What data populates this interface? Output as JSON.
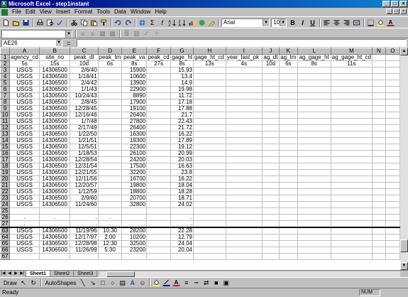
{
  "window": {
    "title": "Microsoft Excel - step1instant"
  },
  "menu": [
    "File",
    "Edit",
    "View",
    "Insert",
    "Format",
    "Tools",
    "Data",
    "Window",
    "Help"
  ],
  "toolbar": {
    "font_name": "Arial",
    "font_size": "10",
    "bold": "B",
    "italic": "I",
    "underline": "U"
  },
  "formula": {
    "cell_ref": "AE26",
    "eq": "="
  },
  "columns": [
    "A",
    "B",
    "C",
    "D",
    "E",
    "F",
    "G",
    "H",
    "I",
    "J",
    "K",
    "L",
    "M",
    "N",
    "O"
  ],
  "header_row1": [
    "agency_cd",
    "site_no",
    "peak_dt",
    "peak_tm",
    "peak_va",
    "peak_cd",
    "gage_ht",
    "gage_ht_cd",
    "year_last_pk",
    "ag_dt",
    "ag_tm",
    "ag_gage_ht",
    "ag_gage_ht_cd",
    "",
    ""
  ],
  "header_row2": [
    "5s",
    "15s",
    "10d",
    "6s",
    "8s",
    "27s",
    "8s",
    "13s",
    "4s",
    "10d",
    "6s",
    "8s",
    "11s",
    "",
    ""
  ],
  "rows": [
    {
      "n": "3",
      "a": "USGS",
      "b": "14306500",
      "c": "2/6/40",
      "d": "",
      "e": "15900",
      "g": "15.93"
    },
    {
      "n": "4",
      "a": "USGS",
      "b": "14306500",
      "c": "1/18/41",
      "d": "",
      "e": "10600",
      "g": "13.4"
    },
    {
      "n": "5",
      "a": "USGS",
      "b": "14306500",
      "c": "2/4/42",
      "d": "",
      "e": "13900",
      "g": "14.9"
    },
    {
      "n": "6",
      "a": "USGS",
      "b": "14306500",
      "c": "1/1/43",
      "d": "",
      "e": "22900",
      "g": "19.98"
    },
    {
      "n": "7",
      "a": "USGS",
      "b": "14306500",
      "c": "10/24/43",
      "d": "",
      "e": "8890",
      "g": "11.72"
    },
    {
      "n": "8",
      "a": "USGS",
      "b": "14306500",
      "c": "2/8/45",
      "d": "",
      "e": "17900",
      "g": "17.18"
    },
    {
      "n": "9",
      "a": "USGS",
      "b": "14306500",
      "c": "12/28/45",
      "d": "",
      "e": "19100",
      "g": "17.88"
    },
    {
      "n": "10",
      "a": "USGS",
      "b": "14306500",
      "c": "12/16/46",
      "d": "",
      "e": "26400",
      "g": "21.7"
    },
    {
      "n": "11",
      "a": "USGS",
      "b": "14306500",
      "c": "1/7/48",
      "d": "",
      "e": "27800",
      "g": "22.43"
    },
    {
      "n": "12",
      "a": "USGS",
      "b": "14306500",
      "c": "2/17/49",
      "d": "",
      "e": "26400",
      "g": "21.72"
    },
    {
      "n": "13",
      "a": "USGS",
      "b": "14306500",
      "c": "1/22/50",
      "d": "",
      "e": "16300",
      "g": "16.22"
    },
    {
      "n": "14",
      "a": "USGS",
      "b": "14306500",
      "c": "1/21/51",
      "d": "",
      "e": "19300",
      "g": "17.89"
    },
    {
      "n": "15",
      "a": "USGS",
      "b": "14306500",
      "c": "12/5/51",
      "d": "",
      "e": "22300",
      "g": "19.12"
    },
    {
      "n": "16",
      "a": "USGS",
      "b": "14306500",
      "c": "1/18/53",
      "d": "",
      "e": "26100",
      "g": "20.99"
    },
    {
      "n": "17",
      "a": "USGS",
      "b": "14306500",
      "c": "12/28/54",
      "d": "",
      "e": "24200",
      "g": "20.03"
    },
    {
      "n": "18",
      "a": "USGS",
      "b": "14306500",
      "c": "12/31/54",
      "d": "",
      "e": "17500",
      "g": "16.63"
    },
    {
      "n": "19",
      "a": "USGS",
      "b": "14306500",
      "c": "12/21/55",
      "d": "",
      "e": "32200",
      "g": "23.8"
    },
    {
      "n": "20",
      "a": "USGS",
      "b": "14306500",
      "c": "12/11/56",
      "d": "",
      "e": "16700",
      "g": "16.22"
    },
    {
      "n": "21",
      "a": "USGS",
      "b": "14306500",
      "c": "12/20/57",
      "d": "",
      "e": "19800",
      "g": "18.04"
    },
    {
      "n": "22",
      "a": "USGS",
      "b": "14306500",
      "c": "1/12/59",
      "d": "",
      "e": "18800",
      "g": "18.28"
    },
    {
      "n": "23",
      "a": "USGS",
      "b": "14306500",
      "c": "2/9/60",
      "d": "",
      "e": "20700",
      "g": "18.71"
    },
    {
      "n": "24",
      "a": "USGS",
      "b": "14306500",
      "c": "11/24/60",
      "d": "",
      "e": "32800",
      "g": "24.02"
    },
    {
      "n": "25",
      "a": "",
      "b": "",
      "c": "",
      "d": "",
      "e": "",
      "g": ""
    },
    {
      "n": "26",
      "a": ".",
      "b": ".",
      "c": ".",
      "d": ".",
      "e": ".",
      "g": "."
    },
    {
      "n": "27",
      "a": ".",
      "b": ".",
      "c": ".",
      "d": ".",
      "e": ".",
      "g": "."
    },
    {
      "n": "63",
      "a": "USGS",
      "b": "14306500",
      "c": "11/19/96",
      "d": "10:30",
      "e": "28200",
      "g": "22.28"
    },
    {
      "n": "64",
      "a": "USGS",
      "b": "14306500",
      "c": "12/17/97",
      "d": "2:00",
      "e": "10200",
      "g": "12.79"
    },
    {
      "n": "65",
      "a": "USGS",
      "b": "14306500",
      "c": "12/28/98",
      "d": "12:30",
      "e": "32500",
      "g": "24.04"
    },
    {
      "n": "66",
      "a": "USGS",
      "b": "14306500",
      "c": "11/26/99",
      "d": "5:30",
      "e": "23200",
      "g": "20.04"
    },
    {
      "n": "67",
      "a": "",
      "b": "",
      "c": "",
      "d": "",
      "e": "",
      "g": ""
    }
  ],
  "sheets": [
    "Sheet1",
    "Sheet2",
    "Sheet3"
  ],
  "drawbar": {
    "draw_label": "Draw",
    "autoshapes_label": "AutoShapes"
  },
  "status": {
    "text": "Ready",
    "num": "NUM"
  }
}
